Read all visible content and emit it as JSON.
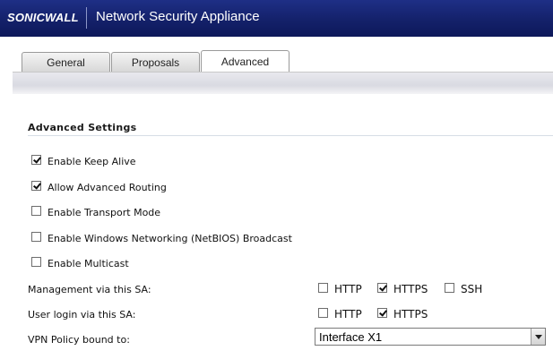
{
  "header": {
    "logo_text": "SONICWALL",
    "product_title": "Network Security Appliance"
  },
  "tabs": [
    {
      "label": "General",
      "active": false
    },
    {
      "label": "Proposals",
      "active": false
    },
    {
      "label": "Advanced",
      "active": true
    }
  ],
  "advanced": {
    "section_title": "Advanced Settings",
    "options": [
      {
        "label": "Enable Keep Alive",
        "checked": true
      },
      {
        "label": "Allow Advanced Routing",
        "checked": true
      },
      {
        "label": "Enable Transport Mode",
        "checked": false
      },
      {
        "label": "Enable Windows Networking (NetBIOS) Broadcast",
        "checked": false
      },
      {
        "label": "Enable Multicast",
        "checked": false
      }
    ],
    "management": {
      "label": "Management via this SA:",
      "http": {
        "label": "HTTP",
        "checked": false
      },
      "https": {
        "label": "HTTPS",
        "checked": true
      },
      "ssh": {
        "label": "SSH",
        "checked": false
      }
    },
    "user_login": {
      "label": "User login via this SA:",
      "http": {
        "label": "HTTP",
        "checked": false
      },
      "https": {
        "label": "HTTPS",
        "checked": true
      }
    },
    "vpn_policy": {
      "label": "VPN Policy bound to:",
      "selected": "Interface X1"
    }
  }
}
